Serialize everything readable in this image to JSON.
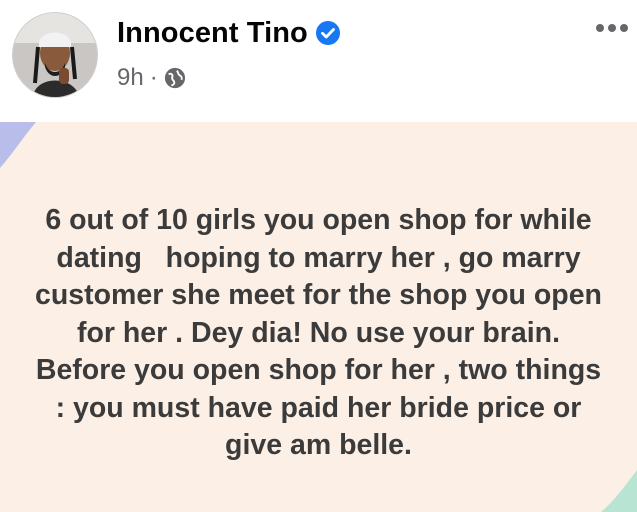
{
  "post": {
    "author": {
      "name": "Innocent Tino",
      "verified": true,
      "avatar_icon": "avatar-photo"
    },
    "time": "9h",
    "separator": "·",
    "audience_icon": "globe-icon",
    "more_icon": "more-options-icon",
    "text": "6 out of 10 girls you open shop for while dating   hoping to marry her , go marry customer she meet for the shop you open for her . Dey dia! No use your brain. Before you open shop for her , two things : you must have paid her bride price or give am belle.",
    "background_color": "#fbefe6",
    "text_color": "#3b3b3b"
  },
  "colors": {
    "verified_blue": "#1877f2",
    "secondary_text": "#65676b",
    "deco_blue": "#b9bde9",
    "deco_green": "#b8e4d4"
  }
}
